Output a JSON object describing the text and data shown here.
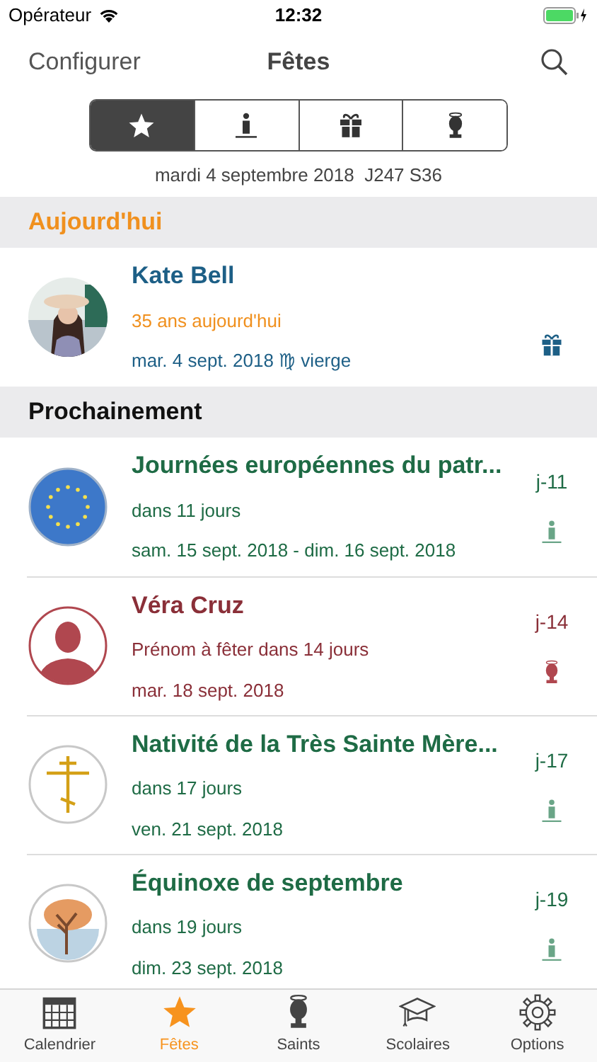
{
  "status_bar": {
    "carrier": "Opérateur",
    "time": "12:32"
  },
  "nav": {
    "left": "Configurer",
    "title": "Fêtes"
  },
  "segments": [
    {
      "kind": "star",
      "selected": true
    },
    {
      "kind": "candle",
      "selected": false
    },
    {
      "kind": "gift",
      "selected": false
    },
    {
      "kind": "saint",
      "selected": false
    }
  ],
  "date_line": "mardi 4 septembre 2018  J247 S36",
  "sections": [
    {
      "kind": "today",
      "title": "Aujourd'hui",
      "rows": [
        {
          "kind": "birthday",
          "title": "Kate Bell",
          "subtitle": "35 ans aujourd'hui",
          "date": "mar. 4 sept. 2018 ♍︎ vierge",
          "color": "#1d5f86"
        }
      ]
    },
    {
      "kind": "upcoming",
      "title": "Prochainement",
      "rows": [
        {
          "kind": "holiday",
          "title": "Journées européennes du patr...",
          "subtitle": "dans 11 jours",
          "date": "sam. 15 sept. 2018 - dim. 16 sept. 2018",
          "countdown": "j-11",
          "color": "#1e6b45"
        },
        {
          "kind": "nameday",
          "title": "Véra Cruz",
          "subtitle": "Prénom à fêter dans 14 jours",
          "date": "mar. 18 sept. 2018",
          "countdown": "j-14",
          "color": "#8a2f38"
        },
        {
          "kind": "holiday",
          "title": "Nativité de la Très Sainte Mère...",
          "subtitle": "dans 17 jours",
          "date": "ven. 21 sept. 2018",
          "countdown": "j-17",
          "color": "#1e6b45"
        },
        {
          "kind": "holiday",
          "title": "Équinoxe de septembre",
          "subtitle": "dans 19 jours",
          "date": "dim. 23 sept. 2018",
          "countdown": "j-19",
          "color": "#1e6b45"
        }
      ]
    }
  ],
  "tab_bar": [
    {
      "label": "Calendrier",
      "selected": false
    },
    {
      "label": "Fêtes",
      "selected": true
    },
    {
      "label": "Saints",
      "selected": false
    },
    {
      "label": "Scolaires",
      "selected": false
    },
    {
      "label": "Options",
      "selected": false
    }
  ]
}
